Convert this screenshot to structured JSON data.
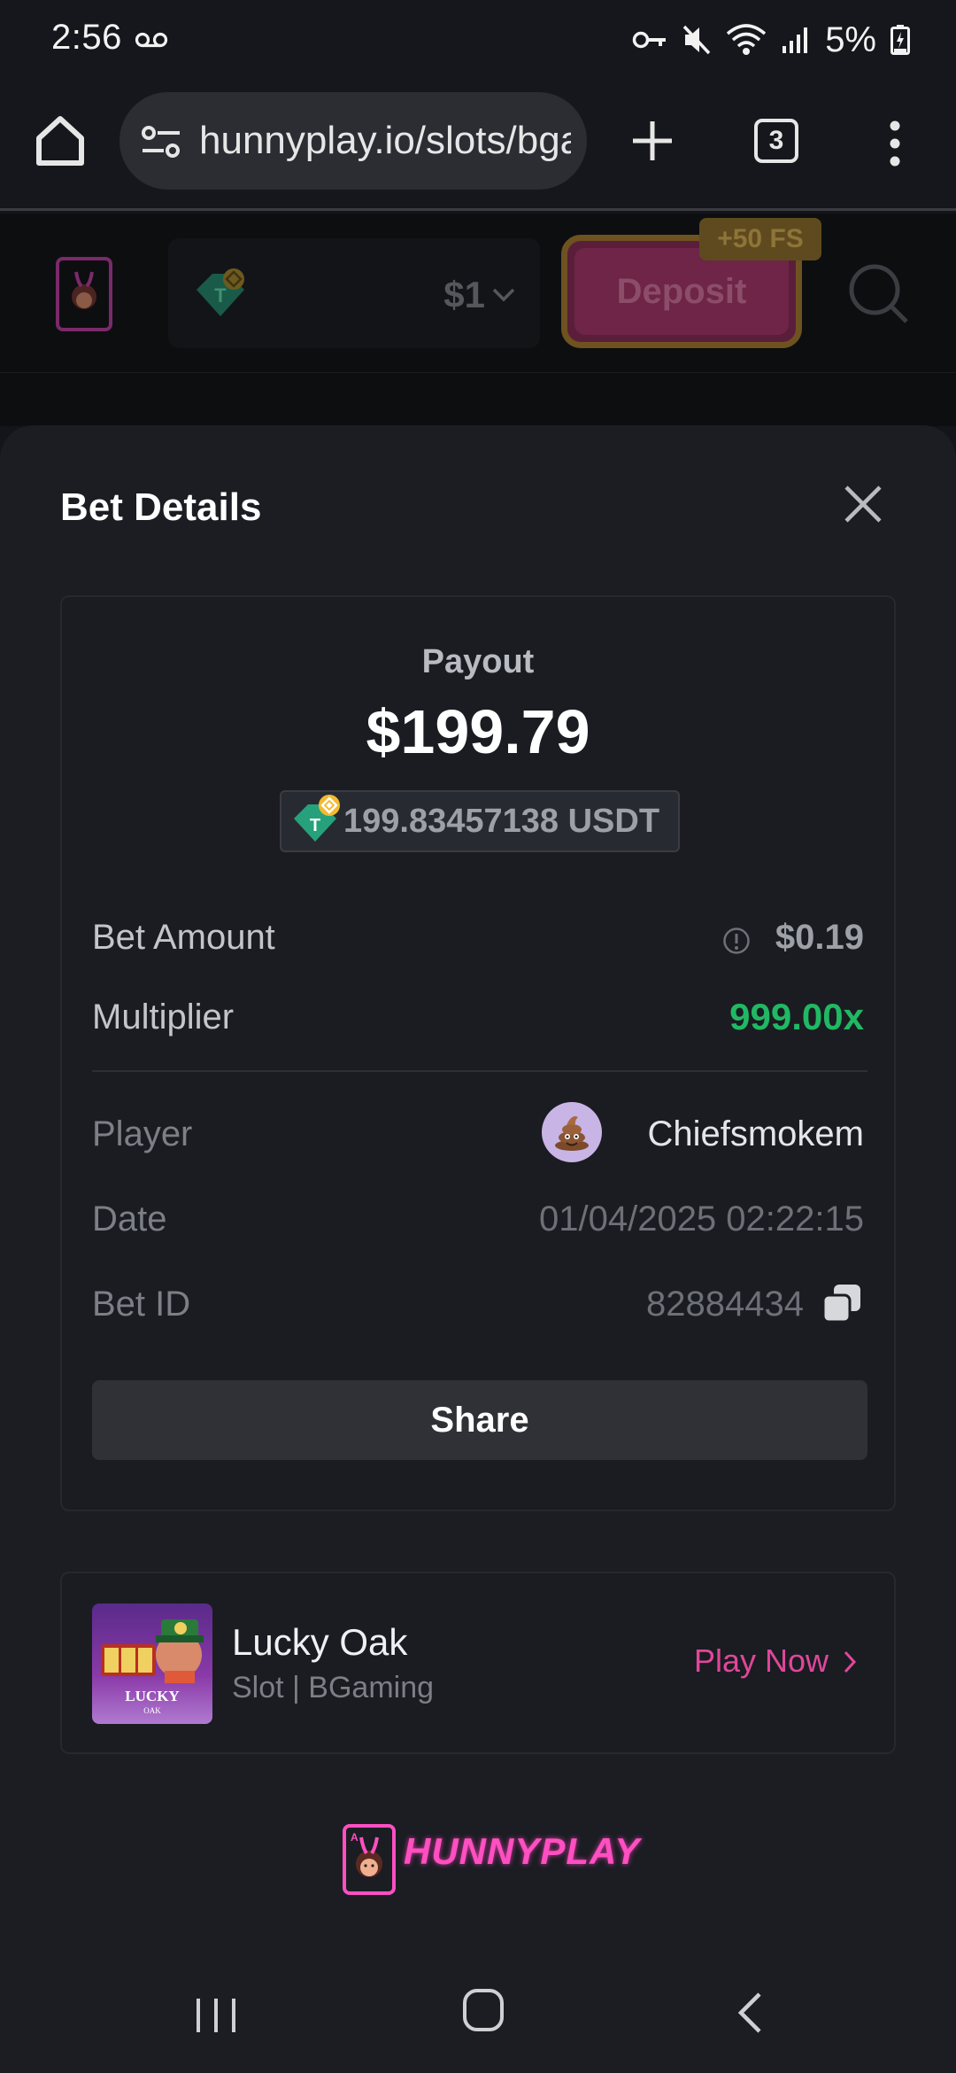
{
  "status_bar": {
    "time": "2:56",
    "battery_percent": "5%",
    "icons": [
      "voicemail-icon",
      "vpn-key-icon",
      "mute-icon",
      "wifi-icon",
      "signal-icon",
      "battery-charging-icon"
    ]
  },
  "browser": {
    "url": "hunnyplay.io/slots/bgaming-lucky-oak",
    "tab_count": "3"
  },
  "site_header": {
    "balance": "$1",
    "deposit_label": "Deposit",
    "bonus_badge": "+50 FS"
  },
  "bet_details": {
    "title": "Bet Details",
    "payout_label": "Payout",
    "payout_value": "$199.79",
    "payout_crypto": "199.83457138 USDT",
    "bet_amount_label": "Bet Amount",
    "bet_amount_value": "$0.19",
    "multiplier_label": "Multiplier",
    "multiplier_value": "999.00x",
    "player_label": "Player",
    "player_name": "Chiefsmokem",
    "date_label": "Date",
    "date_value": "01/04/2025 02:22:15",
    "bet_id_label": "Bet ID",
    "bet_id_value": "82884434",
    "share_label": "Share"
  },
  "game": {
    "title": "Lucky Oak",
    "meta": "Slot | BGaming",
    "play_label": "Play Now",
    "thumb_text_1": "LUCKY",
    "thumb_text_2": "OAK"
  },
  "footer": {
    "brand": "HUNNYPLAY"
  },
  "colors": {
    "accent_pink": "#e0479a",
    "win_green": "#21b864",
    "sheet_bg": "#1b1d23"
  }
}
